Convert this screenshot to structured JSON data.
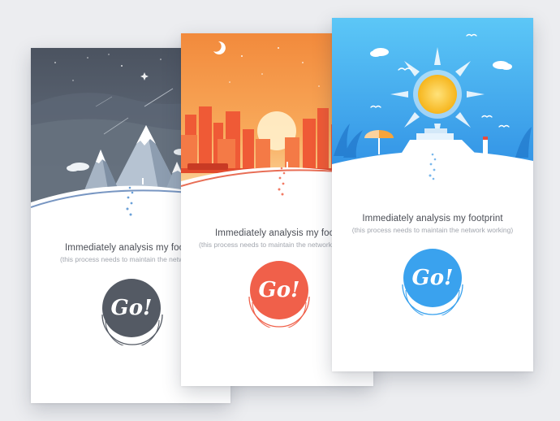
{
  "cards": [
    {
      "theme": "night-mountains",
      "accent": "#545a64",
      "title": "Immediately analysis my footprint",
      "subtitle": "(this process needs to maintain the network working)",
      "button_label": "Go!"
    },
    {
      "theme": "sunset-city",
      "accent": "#f0604a",
      "title": "Immediately analysis my footprint",
      "subtitle": "(this process needs to maintain the network working)",
      "button_label": "Go!"
    },
    {
      "theme": "sunny-beach",
      "accent": "#3aa2ee",
      "title": "Immediately analysis my footprint",
      "subtitle": "(this process needs to maintain the network working)",
      "button_label": "Go!"
    }
  ]
}
